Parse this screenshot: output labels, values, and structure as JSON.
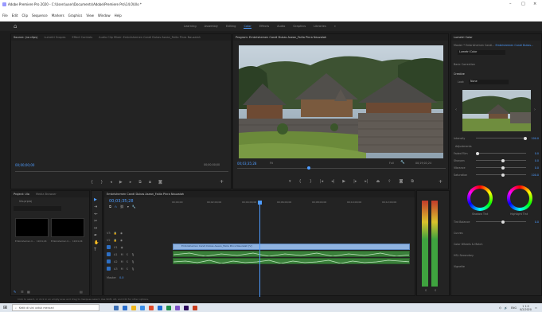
{
  "window": {
    "title": "Adobe Premiere Pro 2020 - C:\\Users\\user\\Documents\\Adobe\\Premiere Pro\\14.0\\Ulo *",
    "controls": [
      "–",
      "□",
      "×"
    ]
  },
  "menu": [
    "File",
    "Edit",
    "Clip",
    "Sequence",
    "Markers",
    "Graphics",
    "View",
    "Window",
    "Help"
  ],
  "workspaces": {
    "items": [
      "Learning",
      "Assembly",
      "Editing",
      "Color",
      "Effects",
      "Audio",
      "Graphics",
      "Libraries"
    ],
    "active": "Color"
  },
  "source_panel": {
    "tabs": [
      "Source: (no clips)",
      "Lumetri Scopes",
      "Effect Controls",
      "Audio Clip Mixer: Embrishemen Candi Dukas Asean_Faiila Pinra Nauzalah"
    ],
    "tc_left": "00;00;00;00",
    "tc_right": "00;00;00;00"
  },
  "program_panel": {
    "tab": "Program: Embrishemen Candi Dukas Asean_Faiila Pinra Nauzalah",
    "tc": "00;03;35;28",
    "fit": "Fit",
    "full": "Full",
    "duration": "00;19;01;24"
  },
  "project_panel": {
    "tabs": [
      "Project: Ulo",
      "Media Browser"
    ],
    "file": "Ulo.prproj",
    "search_placeholder": "",
    "items": [
      {
        "name": "Embrishemen C...",
        "dur": "19;01;24"
      },
      {
        "name": "Embrishemen C...",
        "dur": "19;01;24"
      }
    ]
  },
  "timeline": {
    "tab": "Embrishemen Candi Dukas Asean_Faiila Pinra Nauzalah",
    "tc": "00;03;35;28",
    "ruler": [
      "00;00;00",
      "00;02;00;00",
      "00;04;00;00",
      "00;06;00;00",
      "00;08;00;00",
      "00;10;00;00",
      "00;12;00;00",
      "00;14;00;00"
    ],
    "tracks": [
      "V3",
      "V2",
      "V1",
      "A1",
      "A2",
      "A3"
    ],
    "master": "Master",
    "master_val": "0.0",
    "clip_name": "Embrishemen Candi Dukas Asean_Faiila Pinra Nauzalah [V]"
  },
  "lumetri": {
    "tab": "Lumetri Color",
    "master_label": "Master * Embrishemen Candi...",
    "master_clip": "Embrishemen Candi Dukas...",
    "effect": "Lumetri Color",
    "sections": {
      "basic": "Basic Correction",
      "creative": "Creative",
      "curves": "Curves",
      "wheels": "Color Wheels & Match",
      "hsl": "HSL Secondary",
      "vignette": "Vignette"
    },
    "look_label": "Look",
    "look_value": "None",
    "intensity_label": "Intensity",
    "intensity_val": "100.0",
    "adjustments_label": "Adjustments",
    "sliders": [
      {
        "name": "Faded Film",
        "val": "0.0",
        "pos": 0.0
      },
      {
        "name": "Sharpen",
        "val": "0.0",
        "pos": 0.5
      },
      {
        "name": "Vibrance",
        "val": "0.0",
        "pos": 0.5
      },
      {
        "name": "Saturation",
        "val": "100.0",
        "pos": 0.5
      }
    ],
    "shadow_tint": "Shadow Tint",
    "highlight_tint": "Highlight Tint",
    "tint_balance": "Tint Balance",
    "tint_balance_val": "0.0"
  },
  "status": {
    "text": "Click to select, or click in an empty area and drag to marquee select. Use Shift, Alt, and Ctrl for other options."
  },
  "taskbar": {
    "search_placeholder": "Ketik di sini untuk mencari",
    "time": "1 1:5",
    "date": "0/2/2020",
    "lang": "ENG"
  },
  "colors": {
    "accent": "#4e9cff",
    "clip_video": "#8fb3e0",
    "clip_audio": "#3a7f3a",
    "playhead": "#4e9cff"
  }
}
